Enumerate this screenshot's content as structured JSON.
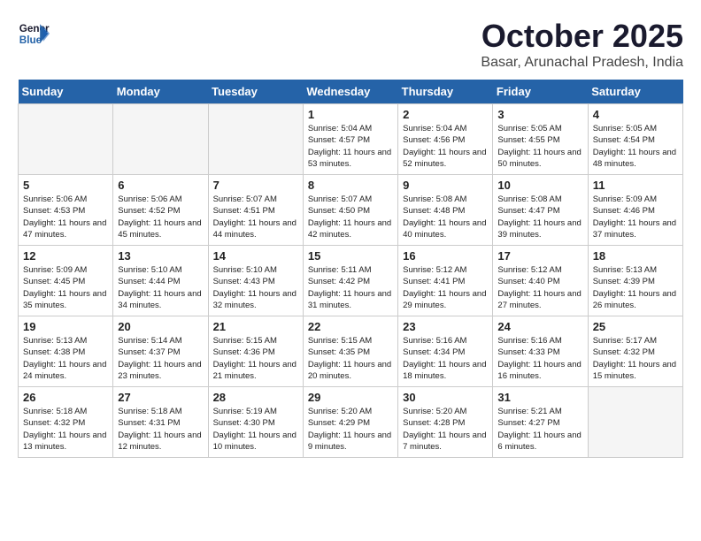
{
  "header": {
    "logo_line1": "General",
    "logo_line2": "Blue",
    "title": "October 2025",
    "subtitle": "Basar, Arunachal Pradesh, India"
  },
  "days_of_week": [
    "Sunday",
    "Monday",
    "Tuesday",
    "Wednesday",
    "Thursday",
    "Friday",
    "Saturday"
  ],
  "weeks": [
    [
      {
        "day": "",
        "sunrise": "",
        "sunset": "",
        "daylight": "",
        "empty": true
      },
      {
        "day": "",
        "sunrise": "",
        "sunset": "",
        "daylight": "",
        "empty": true
      },
      {
        "day": "",
        "sunrise": "",
        "sunset": "",
        "daylight": "",
        "empty": true
      },
      {
        "day": "1",
        "sunrise": "Sunrise: 5:04 AM",
        "sunset": "Sunset: 4:57 PM",
        "daylight": "Daylight: 11 hours and 53 minutes."
      },
      {
        "day": "2",
        "sunrise": "Sunrise: 5:04 AM",
        "sunset": "Sunset: 4:56 PM",
        "daylight": "Daylight: 11 hours and 52 minutes."
      },
      {
        "day": "3",
        "sunrise": "Sunrise: 5:05 AM",
        "sunset": "Sunset: 4:55 PM",
        "daylight": "Daylight: 11 hours and 50 minutes."
      },
      {
        "day": "4",
        "sunrise": "Sunrise: 5:05 AM",
        "sunset": "Sunset: 4:54 PM",
        "daylight": "Daylight: 11 hours and 48 minutes."
      }
    ],
    [
      {
        "day": "5",
        "sunrise": "Sunrise: 5:06 AM",
        "sunset": "Sunset: 4:53 PM",
        "daylight": "Daylight: 11 hours and 47 minutes."
      },
      {
        "day": "6",
        "sunrise": "Sunrise: 5:06 AM",
        "sunset": "Sunset: 4:52 PM",
        "daylight": "Daylight: 11 hours and 45 minutes."
      },
      {
        "day": "7",
        "sunrise": "Sunrise: 5:07 AM",
        "sunset": "Sunset: 4:51 PM",
        "daylight": "Daylight: 11 hours and 44 minutes."
      },
      {
        "day": "8",
        "sunrise": "Sunrise: 5:07 AM",
        "sunset": "Sunset: 4:50 PM",
        "daylight": "Daylight: 11 hours and 42 minutes."
      },
      {
        "day": "9",
        "sunrise": "Sunrise: 5:08 AM",
        "sunset": "Sunset: 4:48 PM",
        "daylight": "Daylight: 11 hours and 40 minutes."
      },
      {
        "day": "10",
        "sunrise": "Sunrise: 5:08 AM",
        "sunset": "Sunset: 4:47 PM",
        "daylight": "Daylight: 11 hours and 39 minutes."
      },
      {
        "day": "11",
        "sunrise": "Sunrise: 5:09 AM",
        "sunset": "Sunset: 4:46 PM",
        "daylight": "Daylight: 11 hours and 37 minutes."
      }
    ],
    [
      {
        "day": "12",
        "sunrise": "Sunrise: 5:09 AM",
        "sunset": "Sunset: 4:45 PM",
        "daylight": "Daylight: 11 hours and 35 minutes."
      },
      {
        "day": "13",
        "sunrise": "Sunrise: 5:10 AM",
        "sunset": "Sunset: 4:44 PM",
        "daylight": "Daylight: 11 hours and 34 minutes."
      },
      {
        "day": "14",
        "sunrise": "Sunrise: 5:10 AM",
        "sunset": "Sunset: 4:43 PM",
        "daylight": "Daylight: 11 hours and 32 minutes."
      },
      {
        "day": "15",
        "sunrise": "Sunrise: 5:11 AM",
        "sunset": "Sunset: 4:42 PM",
        "daylight": "Daylight: 11 hours and 31 minutes."
      },
      {
        "day": "16",
        "sunrise": "Sunrise: 5:12 AM",
        "sunset": "Sunset: 4:41 PM",
        "daylight": "Daylight: 11 hours and 29 minutes."
      },
      {
        "day": "17",
        "sunrise": "Sunrise: 5:12 AM",
        "sunset": "Sunset: 4:40 PM",
        "daylight": "Daylight: 11 hours and 27 minutes."
      },
      {
        "day": "18",
        "sunrise": "Sunrise: 5:13 AM",
        "sunset": "Sunset: 4:39 PM",
        "daylight": "Daylight: 11 hours and 26 minutes."
      }
    ],
    [
      {
        "day": "19",
        "sunrise": "Sunrise: 5:13 AM",
        "sunset": "Sunset: 4:38 PM",
        "daylight": "Daylight: 11 hours and 24 minutes."
      },
      {
        "day": "20",
        "sunrise": "Sunrise: 5:14 AM",
        "sunset": "Sunset: 4:37 PM",
        "daylight": "Daylight: 11 hours and 23 minutes."
      },
      {
        "day": "21",
        "sunrise": "Sunrise: 5:15 AM",
        "sunset": "Sunset: 4:36 PM",
        "daylight": "Daylight: 11 hours and 21 minutes."
      },
      {
        "day": "22",
        "sunrise": "Sunrise: 5:15 AM",
        "sunset": "Sunset: 4:35 PM",
        "daylight": "Daylight: 11 hours and 20 minutes."
      },
      {
        "day": "23",
        "sunrise": "Sunrise: 5:16 AM",
        "sunset": "Sunset: 4:34 PM",
        "daylight": "Daylight: 11 hours and 18 minutes."
      },
      {
        "day": "24",
        "sunrise": "Sunrise: 5:16 AM",
        "sunset": "Sunset: 4:33 PM",
        "daylight": "Daylight: 11 hours and 16 minutes."
      },
      {
        "day": "25",
        "sunrise": "Sunrise: 5:17 AM",
        "sunset": "Sunset: 4:32 PM",
        "daylight": "Daylight: 11 hours and 15 minutes."
      }
    ],
    [
      {
        "day": "26",
        "sunrise": "Sunrise: 5:18 AM",
        "sunset": "Sunset: 4:32 PM",
        "daylight": "Daylight: 11 hours and 13 minutes."
      },
      {
        "day": "27",
        "sunrise": "Sunrise: 5:18 AM",
        "sunset": "Sunset: 4:31 PM",
        "daylight": "Daylight: 11 hours and 12 minutes."
      },
      {
        "day": "28",
        "sunrise": "Sunrise: 5:19 AM",
        "sunset": "Sunset: 4:30 PM",
        "daylight": "Daylight: 11 hours and 10 minutes."
      },
      {
        "day": "29",
        "sunrise": "Sunrise: 5:20 AM",
        "sunset": "Sunset: 4:29 PM",
        "daylight": "Daylight: 11 hours and 9 minutes."
      },
      {
        "day": "30",
        "sunrise": "Sunrise: 5:20 AM",
        "sunset": "Sunset: 4:28 PM",
        "daylight": "Daylight: 11 hours and 7 minutes."
      },
      {
        "day": "31",
        "sunrise": "Sunrise: 5:21 AM",
        "sunset": "Sunset: 4:27 PM",
        "daylight": "Daylight: 11 hours and 6 minutes."
      },
      {
        "day": "",
        "sunrise": "",
        "sunset": "",
        "daylight": "",
        "empty": true
      }
    ]
  ]
}
